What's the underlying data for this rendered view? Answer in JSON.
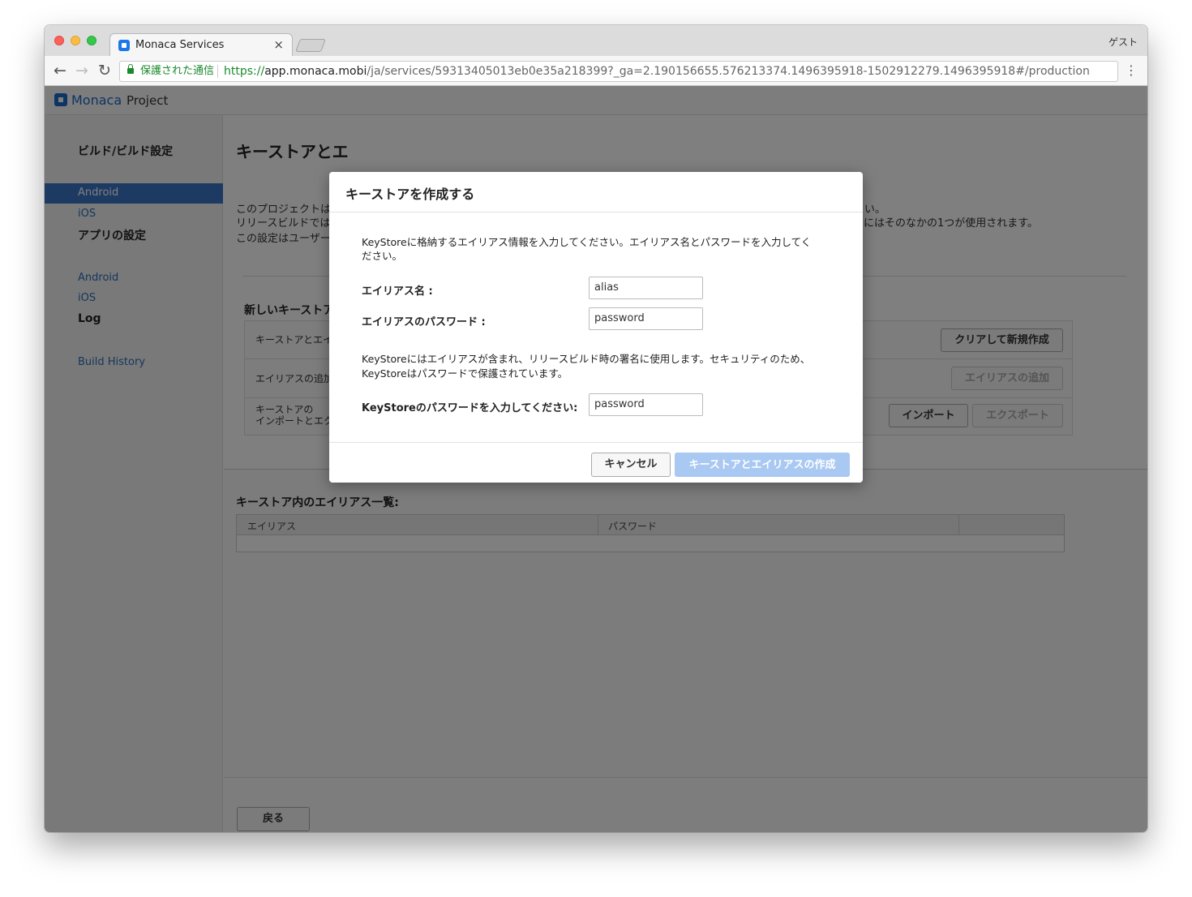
{
  "browser": {
    "tab_title": "Monaca Services",
    "tab_close": "×",
    "guest_label": "ゲスト",
    "secure_label": "保護された通信",
    "url_scheme": "https://",
    "url_host": "app.monaca.mobi",
    "url_path": "/ja/services/59313405013eb0e35a218399?_ga=2.190156655.576213374.1496395918-1502912279.1496395918#/production",
    "back_icon": "←",
    "forward_icon": "→",
    "reload_icon": "↻",
    "menu_icon": "⋮"
  },
  "app": {
    "logo": "Monaca",
    "project_label": "Project"
  },
  "sidebar": {
    "build_heading": "ビルド/ビルド設定",
    "build_items": [
      "Android",
      "iOS"
    ],
    "app_heading": "アプリの設定",
    "app_items": [
      "Android",
      "iOS"
    ],
    "log_heading": "Log",
    "log_items": [
      "Build History"
    ]
  },
  "main": {
    "title": "キーストアとエ",
    "desc_lines": [
      "このプロジェクトは",
      "リリースビルドでは",
      "この設定はユーザー"
    ],
    "desc_right_lines": [
      "い。",
      "にはそのなかの1つが使用されます。"
    ],
    "new_keystore_title": "新しいキーストア",
    "rows": [
      {
        "label": "キーストアとエイ"
      },
      {
        "label": "エイリアスの追加"
      },
      {
        "label_line1": "キーストアの",
        "label_line2": "インポートとエク"
      }
    ],
    "clear_button": "クリアして新規作成",
    "add_alias_button": "エイリアスの追加",
    "import_button": "インポート",
    "export_button": "エクスポート",
    "alias_list_title": "キーストア内のエイリアス一覧:",
    "alias_columns": [
      "エイリアス",
      "パスワード",
      ""
    ],
    "back_button": "戻る"
  },
  "modal": {
    "title": "キーストアを作成する",
    "intro_line1": "KeyStoreに格納するエイリアス情報を入力してください。エイリアス名とパスワードを入力してく",
    "intro_line2": "ださい。",
    "alias_label": "エイリアス名 :",
    "alias_value": "alias",
    "alias_password_label": "エイリアスのパスワード :",
    "alias_password_value": "password",
    "keystore_note_line1": "KeyStoreにはエイリアスが含まれ、リリースビルド時の署名に使用します。セキュリティのため、",
    "keystore_note_line2": "KeyStoreはパスワードで保護されています。",
    "keystore_password_label": "KeyStoreのパスワードを入力してください:",
    "keystore_password_value": "password",
    "cancel_button": "キャンセル",
    "create_button": "キーストアとエイリアスの作成"
  },
  "colors": {
    "accent": "#3a75c6",
    "primary_disabled": "#a9c8f2",
    "secure_green": "#1a8a2c"
  }
}
